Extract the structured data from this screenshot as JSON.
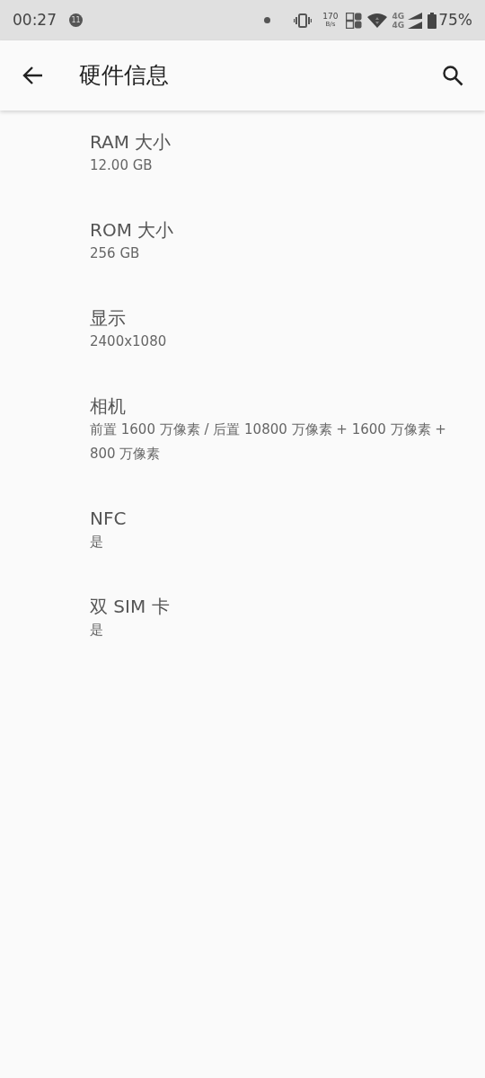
{
  "status_bar": {
    "time": "00:27",
    "notification_count": "11",
    "net_speed": "170",
    "net_unit": "B/s",
    "network_top": "4G",
    "network_bottom": "4G",
    "battery": "75%"
  },
  "app_bar": {
    "title": "硬件信息"
  },
  "items": [
    {
      "title": "RAM 大小",
      "value": "12.00 GB"
    },
    {
      "title": "ROM 大小",
      "value": "256 GB"
    },
    {
      "title": "显示",
      "value": "2400x1080"
    },
    {
      "title": "相机",
      "value": "前置 1600 万像素 / 后置 10800 万像素 + 1600 万像素 + 800 万像素"
    },
    {
      "title": "NFC",
      "value": "是"
    },
    {
      "title": "双 SIM 卡",
      "value": "是"
    }
  ]
}
